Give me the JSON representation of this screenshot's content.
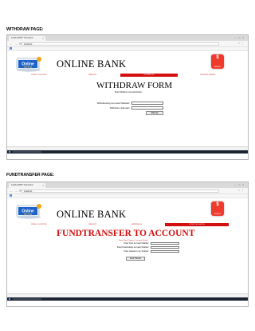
{
  "sections": [
    {
      "heading": "WITHDRAW PAGE:",
      "browser": {
        "tab_title": "localhost/BRT Transaction",
        "url": "localhost/…"
      },
      "page": {
        "bank_name": "ONLINE BANK",
        "logo_text": "Online Banking",
        "badge_text": "BANKING",
        "menu": [
          "VIEW ACCOUNTS",
          "DEPOSIT",
          "WITHDRAW",
          "FUND TRANSFER"
        ],
        "active_menu_index": 2,
        "form_title": "WITHDRAW FORM",
        "form_subtitle": "Enter Withdraw Account Details",
        "fields": [
          {
            "label": "Withdrawing Account Number:"
          },
          {
            "label": "Withdraw Amount:"
          }
        ],
        "button": "Withdraw"
      }
    },
    {
      "heading": "FUNDTRANSFER PAGE:",
      "browser": {
        "tab_title": "localhost/BRT Transaction",
        "url": "localhost/…"
      },
      "page": {
        "bank_name": "ONLINE BANK",
        "logo_text": "Online Banking",
        "badge_text": "BANKING",
        "menu": [
          "VIEW ACCOUNTS",
          "DEPOSIT",
          "WITHDRAW",
          "FUND TRANSFER"
        ],
        "active_menu_index": 3,
        "form_title": "FUNDTRANSFER TO ACCOUNT",
        "form_subtitle": "Enter Fund Transfer Account Details",
        "fields": [
          {
            "label": "Enter Your Account Number:"
          },
          {
            "label": "Enter Fundtransfer Account Number:"
          },
          {
            "label": "Enter Amount to be Transfer:"
          }
        ],
        "button": "Fund Transfer"
      }
    }
  ],
  "colors": {
    "brand_red": "#d40f0f",
    "badge_red": "#ee3b2d",
    "logo_blue": "#1d62c8"
  },
  "icons": [
    "back-icon",
    "forward-icon",
    "reload-icon",
    "star-icon",
    "menu-icon",
    "close-icon",
    "windows-icon"
  ]
}
